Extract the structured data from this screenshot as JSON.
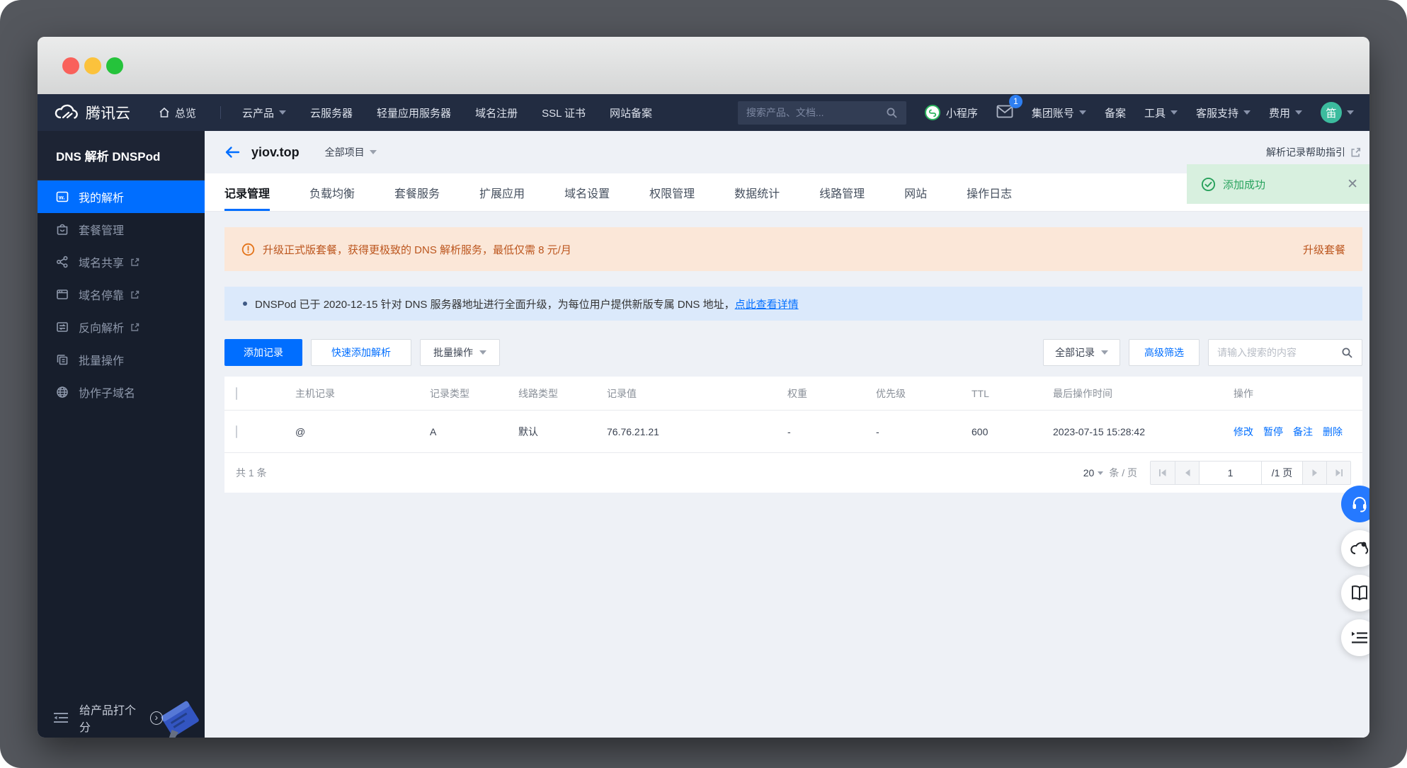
{
  "navbar": {
    "brand": "腾讯云",
    "overview": "总览",
    "items": [
      "云产品",
      "云服务器",
      "轻量应用服务器",
      "域名注册",
      "SSL 证书",
      "网站备案"
    ],
    "search_placeholder": "搜索产品、文档...",
    "mini_program": "小程序",
    "mail_badge": "1",
    "account": "集团账号",
    "beian": "备案",
    "tools": "工具",
    "support": "客服支持",
    "billing": "费用",
    "avatar_text": "笛"
  },
  "sidebar": {
    "title": "DNS 解析 DNSPod",
    "items": [
      {
        "label": "我的解析"
      },
      {
        "label": "套餐管理"
      },
      {
        "label": "域名共享"
      },
      {
        "label": "域名停靠"
      },
      {
        "label": "反向解析"
      },
      {
        "label": "批量操作"
      },
      {
        "label": "协作子域名"
      }
    ],
    "footer_label": "给产品打个分"
  },
  "header": {
    "domain": "yiov.top",
    "project": "全部项目",
    "help_link": "解析记录帮助指引"
  },
  "tabs": [
    {
      "label": "记录管理"
    },
    {
      "label": "负载均衡"
    },
    {
      "label": "套餐服务"
    },
    {
      "label": "扩展应用"
    },
    {
      "label": "域名设置"
    },
    {
      "label": "权限管理"
    },
    {
      "label": "数据统计"
    },
    {
      "label": "线路管理"
    },
    {
      "label": "网站"
    },
    {
      "label": "操作日志"
    }
  ],
  "toast": {
    "message": "添加成功"
  },
  "banners": {
    "upgrade_text": "升级正式版套餐，获得更极致的 DNS 解析服务，最低仅需 8 元/月",
    "upgrade_action": "升级套餐",
    "notice_text": "DNSPod 已于 2020-12-15 针对 DNS 服务器地址进行全面升级，为每位用户提供新版专属 DNS 地址，",
    "notice_link": "点此查看详情"
  },
  "toolbar": {
    "add": "添加记录",
    "quick_add": "快速添加解析",
    "batch": "批量操作",
    "filter_all": "全部记录",
    "advanced": "高级筛选",
    "search_placeholder": "请输入搜索的内容"
  },
  "table": {
    "headers": [
      "主机记录",
      "记录类型",
      "线路类型",
      "记录值",
      "权重",
      "优先级",
      "TTL",
      "最后操作时间",
      "操作"
    ],
    "row": {
      "host": "@",
      "type": "A",
      "line": "默认",
      "value": "76.76.21.21",
      "weight": "-",
      "priority": "-",
      "ttl": "600",
      "updated": "2023-07-15 15:28:42",
      "actions": [
        "修改",
        "暂停",
        "备注",
        "删除"
      ]
    }
  },
  "pagination": {
    "total": "共 1 条",
    "page_size": "20",
    "unit": "条 / 页",
    "page": "1",
    "pages_label": "/1 页"
  },
  "icons": {
    "close": "✕",
    "chevron_right": "›",
    "my_dns_glyph": "w."
  },
  "colors": {
    "accent_blue": "#006eff",
    "navbar_bg": "#222c41",
    "sidebar_bg": "#171e2c",
    "success_green": "#28a35e",
    "warning_orange": "#e37318",
    "warning_text": "#bc561e",
    "avatar_green": "#3cbc9e"
  }
}
